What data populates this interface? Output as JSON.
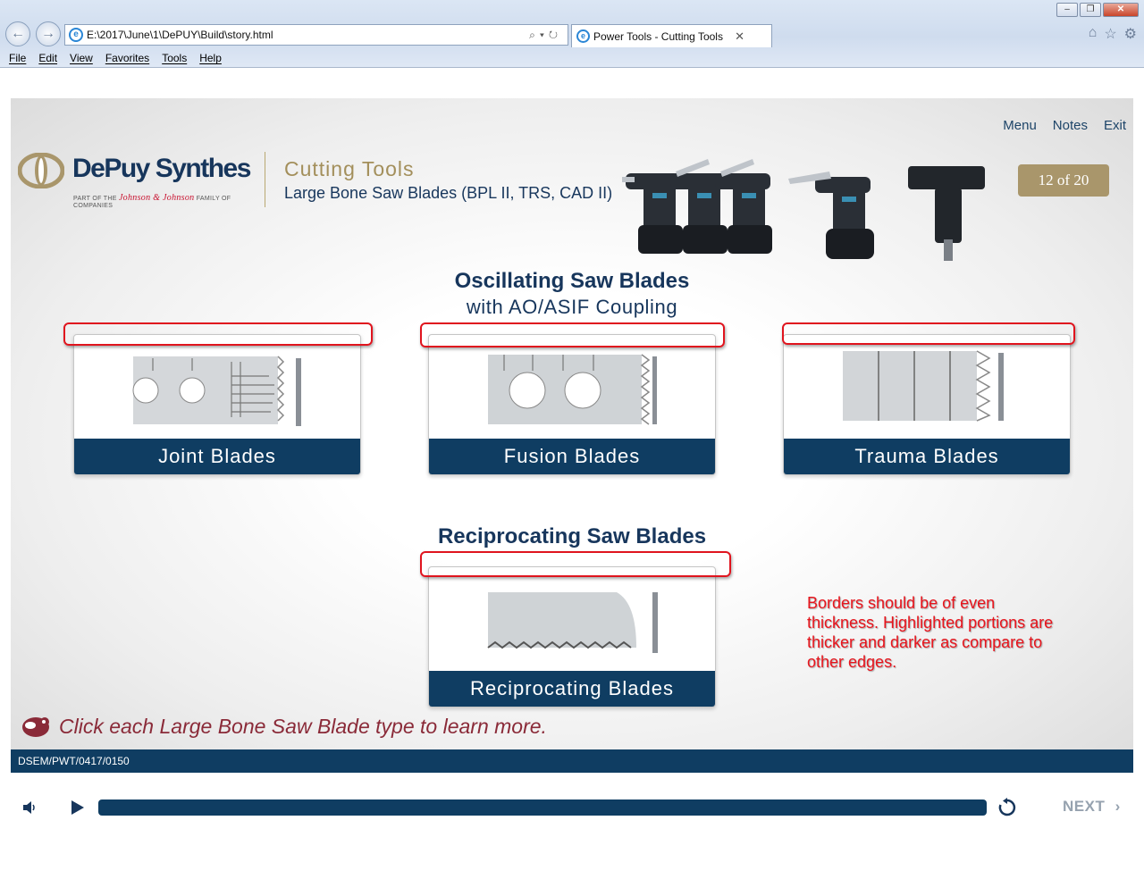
{
  "browser": {
    "url": "E:\\2017\\June\\1\\DePUY\\Build\\story.html",
    "tab_title": "Power Tools - Cutting Tools",
    "menu": [
      "File",
      "Edit",
      "View",
      "Favorites",
      "Tools",
      "Help"
    ]
  },
  "topnav": {
    "menu": "Menu",
    "notes": "Notes",
    "exit": "Exit"
  },
  "logo": {
    "brand": "DePuy Synthes",
    "tagline_pre": "PART OF THE",
    "tagline_jj": "Johnson & Johnson",
    "tagline_post": "FAMILY OF COMPANIES"
  },
  "course": {
    "title": "Cutting Tools",
    "subtitle": "Large Bone Saw Blades (BPL II, TRS, CAD II)",
    "page": "12 of 20"
  },
  "oscillating": {
    "heading": "Oscillating Saw Blades",
    "subheading": "with AO/ASIF Coupling",
    "cards": [
      {
        "label": "Joint Blades"
      },
      {
        "label": "Fusion Blades"
      },
      {
        "label": "Trauma Blades"
      }
    ]
  },
  "reciprocating": {
    "heading": "Reciprocating Saw Blades",
    "cards": [
      {
        "label": "Reciprocating Blades"
      }
    ]
  },
  "annotation": "Borders should be of even thickness. Highlighted portions are thicker and darker as compare to other edges.",
  "instruction": "Click each Large Bone Saw Blade type to learn more.",
  "footer_code": "DSEM/PWT/0417/0150",
  "player": {
    "next_label": "NEXT"
  },
  "colors": {
    "navy": "#0f3d62",
    "gold": "#a9966b",
    "highlight": "#e0141e"
  }
}
